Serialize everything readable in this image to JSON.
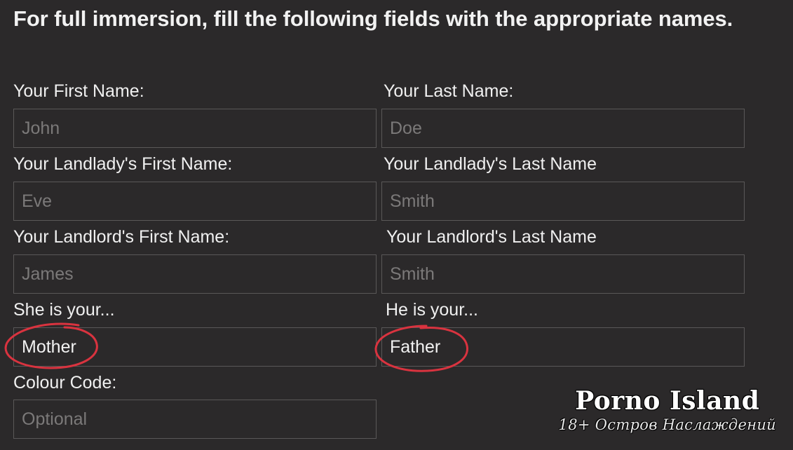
{
  "header": {
    "title": "For full immersion, fill the following fields with the appropriate names."
  },
  "form": {
    "first_name": {
      "label": "Your First Name:",
      "placeholder": "John",
      "value": ""
    },
    "last_name": {
      "label": "Your Last Name:",
      "placeholder": "Doe",
      "value": ""
    },
    "landlady_first": {
      "label": "Your Landlady's First Name:",
      "placeholder": "Eve",
      "value": ""
    },
    "landlady_last": {
      "label": "Your Landlady's Last Name",
      "placeholder": "Smith",
      "value": ""
    },
    "landlord_first": {
      "label": "Your Landlord's First Name:",
      "placeholder": "James",
      "value": ""
    },
    "landlord_last": {
      "label": "Your Landlord's Last Name",
      "placeholder": "Smith",
      "value": ""
    },
    "she_is": {
      "label": "She is your...",
      "value": "Mother"
    },
    "he_is": {
      "label": "He is your...",
      "value": "Father"
    },
    "colour_code": {
      "label": "Colour Code:",
      "placeholder": "Optional",
      "value": ""
    }
  },
  "annotations": {
    "circle_color": "#d9333f"
  },
  "watermark": {
    "title": "Porno Island",
    "subtitle": "18+ Остров Наслаждений"
  }
}
